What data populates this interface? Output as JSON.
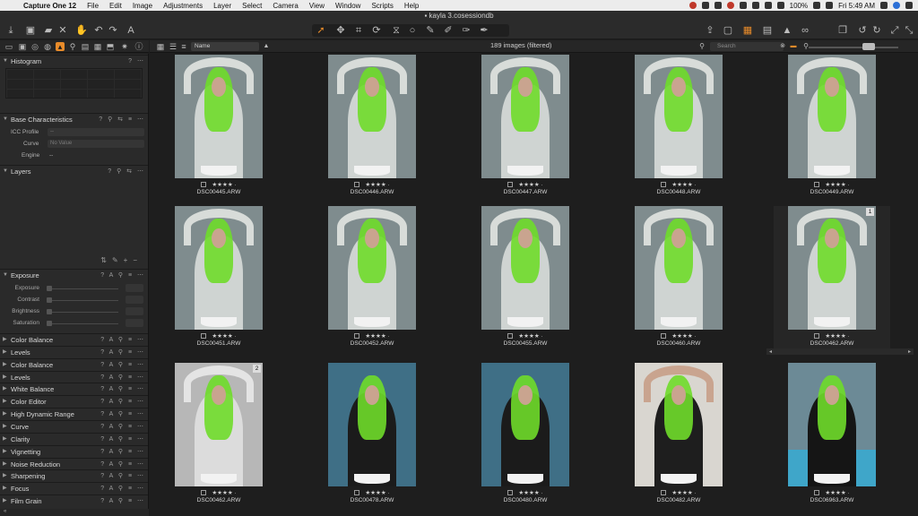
{
  "menubar": {
    "app": "Capture One 12",
    "items": [
      "File",
      "Edit",
      "Image",
      "Adjustments",
      "Layer",
      "Select",
      "Camera",
      "View",
      "Window",
      "Scripts",
      "Help"
    ],
    "battery": "100%",
    "clock": "Fri 5:49 AM"
  },
  "window": {
    "title": "kayla 3.cosessiondb"
  },
  "left": {
    "histogram": {
      "title": "Histogram"
    },
    "base": {
      "title": "Base Characteristics",
      "icc_label": "ICC Profile",
      "icc_value": "--",
      "curve_label": "Curve",
      "curve_value": "No Value",
      "engine_label": "Engine",
      "engine_value": "--"
    },
    "layers": {
      "title": "Layers"
    },
    "exposure": {
      "title": "Exposure",
      "sliders": [
        "Exposure",
        "Contrast",
        "Brightness",
        "Saturation"
      ]
    },
    "sections": [
      "Color Balance",
      "Levels",
      "Color Balance",
      "Levels",
      "White Balance",
      "Color Editor",
      "High Dynamic Range",
      "Curve",
      "Clarity",
      "Vignetting",
      "Noise Reduction",
      "Sharpening",
      "Focus",
      "Film Grain"
    ]
  },
  "browser": {
    "sort_value": "Name",
    "count": "189 images (filtered)",
    "search_placeholder": "Search",
    "images": [
      {
        "name": "DSC00445.ARW",
        "stars": "★★★★ ·",
        "badge": "",
        "style": "a"
      },
      {
        "name": "DSC00446.ARW",
        "stars": "★★★★ ·",
        "badge": "",
        "style": "a"
      },
      {
        "name": "DSC00447.ARW",
        "stars": "★★★★ ·",
        "badge": "",
        "style": "a"
      },
      {
        "name": "DSC00448.ARW",
        "stars": "★★★★ ·",
        "badge": "",
        "style": "a"
      },
      {
        "name": "DSC00449.ARW",
        "stars": "★★★★ ·",
        "badge": "",
        "style": "a"
      },
      {
        "name": "DSC00451.ARW",
        "stars": "★★★★ ·",
        "badge": "",
        "style": "a"
      },
      {
        "name": "DSC00452.ARW",
        "stars": "★★★★ ·",
        "badge": "",
        "style": "a"
      },
      {
        "name": "DSC00455.ARW",
        "stars": "★★★★ ·",
        "badge": "",
        "style": "a"
      },
      {
        "name": "DSC00460.ARW",
        "stars": "★★★★ ·",
        "badge": "",
        "style": "a"
      },
      {
        "name": "DSC00462.ARW",
        "stars": "★★★★ ·",
        "badge": "1",
        "style": "a"
      },
      {
        "name": "DSC00462.ARW",
        "stars": "★★★★ ·",
        "badge": "2",
        "style": "bw"
      },
      {
        "name": "DSC00478.ARW",
        "stars": "★★★★ ·",
        "badge": "",
        "style": "dark"
      },
      {
        "name": "DSC00480.ARW",
        "stars": "★★★★ ·",
        "badge": "",
        "style": "dark"
      },
      {
        "name": "DSC00482.ARW",
        "stars": "★★★★ ·",
        "badge": "",
        "style": "light"
      },
      {
        "name": "DSC06963.ARW",
        "stars": "★★★★ ·",
        "badge": "",
        "style": "pool"
      }
    ]
  },
  "colors": {
    "accent": "#e88b2a",
    "mask_green": "#6fdc2a"
  }
}
